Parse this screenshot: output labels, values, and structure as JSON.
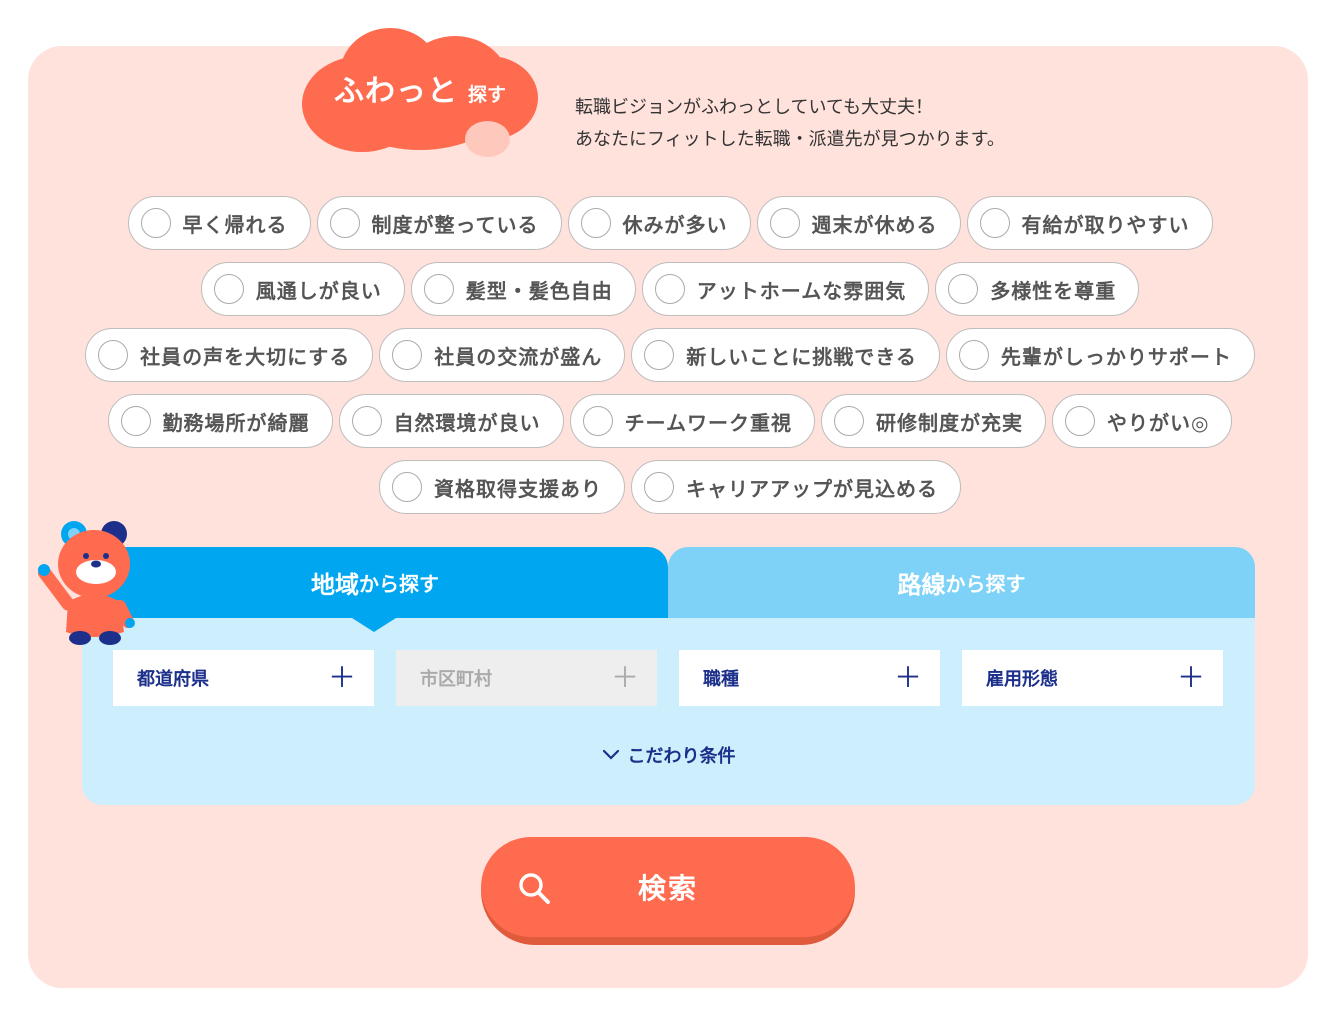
{
  "header": {
    "title_main": "ふわっと",
    "title_sub": "探す",
    "intro_line1": "転職ビジョンがふわっとしていても大丈夫！",
    "intro_line2": "あなたにフィットした転職・派遣先が見つかります。"
  },
  "chips": {
    "row1": [
      "早く帰れる",
      "制度が整っている",
      "休みが多い",
      "週末が休める",
      "有給が取りやすい"
    ],
    "row2": [
      "風通しが良い",
      "髪型・髪色自由",
      "アットホームな雰囲気",
      "多様性を尊重"
    ],
    "row3": [
      "社員の声を大切にする",
      "社員の交流が盛ん",
      "新しいことに挑戦できる",
      "先輩がしっかりサポート"
    ],
    "row4": [
      "勤務場所が綺麗",
      "自然環境が良い",
      "チームワーク重視",
      "研修制度が充実",
      "やりがい◎"
    ],
    "row5": [
      "資格取得支援あり",
      "キャリアアップが見込める"
    ]
  },
  "tabs": {
    "area": {
      "big": "地域",
      "small": "から探す"
    },
    "line": {
      "big": "路線",
      "small": "から探す"
    }
  },
  "selects": {
    "prefecture": "都道府県",
    "city": "市区町村",
    "job": "職種",
    "employment": "雇用形態",
    "plus": "＋"
  },
  "more_conditions": "こだわり条件",
  "search_button": "検索",
  "colors": {
    "panel_bg": "#ffe2dc",
    "accent_orange": "#ff6b4f",
    "tab_active": "#00a7f0",
    "tab_inactive": "#7fd2f7",
    "navy_text": "#1c2f8a"
  }
}
